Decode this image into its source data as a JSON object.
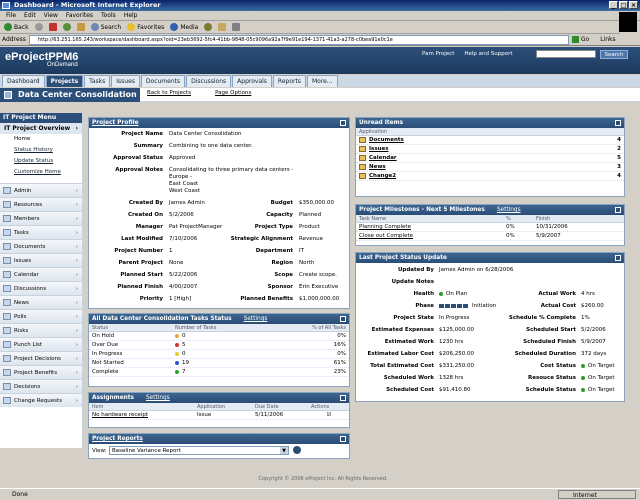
{
  "window": {
    "title": "Dashboard - Microsoft Internet Explorer"
  },
  "menubar": [
    "File",
    "Edit",
    "View",
    "Favorites",
    "Tools",
    "Help"
  ],
  "toolbar": {
    "back": "Back",
    "search": "Search",
    "favorites": "Favorites",
    "media": "Media"
  },
  "address": {
    "label": "Address",
    "url": "http://63.251.165.243/workspace/dashboard.aspx?oid=23eb3692-5fc4-41bb-9848-05c9096a92a7f9e91e194-1371-41a3-a278-c0bea91e0c1e",
    "go": "Go",
    "links": "Links"
  },
  "app": {
    "logo": "eProjectPPM6",
    "logo_sub": "OnDemand",
    "top_links": [
      "Pam Project",
      "Help and Support"
    ],
    "search_button": "Search",
    "tabs": [
      "Dashboard",
      "Projects",
      "Tasks",
      "Issues",
      "Documents",
      "Discussions",
      "Approvals",
      "Reports",
      "More..."
    ],
    "active_tab": "Projects",
    "page_title": "Data Center Consolidation",
    "subnav": [
      "Back to Projects",
      "Page Options"
    ]
  },
  "left_menu": {
    "header": "IT Project Menu",
    "section": "IT Project Overview",
    "links": [
      "Home",
      "Status History",
      "Update Status",
      "Customize Home"
    ],
    "items": [
      "Admin",
      "Resources",
      "Members",
      "Tasks",
      "Documents",
      "Issues",
      "Calendar",
      "Discussions",
      "News",
      "Polls",
      "Risks",
      "Punch List",
      "Project Decisions",
      "Project Benefits",
      "Decisions",
      "Change Requests"
    ]
  },
  "profile": {
    "title": "Project Profile",
    "project_name_label": "Project Name",
    "project_name": "Data Center Consolidation",
    "summary_label": "Summary",
    "summary": "Combining to one data center.",
    "approval_status_label": "Approval Status",
    "approval_status": "Approved",
    "approval_notes_label": "Approval Notes",
    "approval_notes": [
      "Consolidating to three primary data centers -",
      "Europe -",
      "East Coast",
      "West Coast"
    ],
    "left": [
      {
        "label": "Created By",
        "value": "James Admin"
      },
      {
        "label": "Created On",
        "value": "5/2/2006"
      },
      {
        "label": "Manager",
        "value": "Pat ProjectManager"
      },
      {
        "label": "Last Modified",
        "value": "7/10/2006"
      },
      {
        "label": "Project Number",
        "value": "1"
      },
      {
        "label": "Parent Project",
        "value": "None"
      },
      {
        "label": "Planned Start",
        "value": "5/22/2006"
      },
      {
        "label": "Planned Finish",
        "value": "4/00/2007"
      },
      {
        "label": "Priority",
        "value": "1 [High]"
      }
    ],
    "right": [
      {
        "label": "Budget",
        "value": "$350,000.00"
      },
      {
        "label": "Capacity",
        "value": "Planned"
      },
      {
        "label": "Project Type",
        "value": "Product"
      },
      {
        "label": "Strategic Alignment",
        "value": "Revenue"
      },
      {
        "label": "Department",
        "value": "IT"
      },
      {
        "label": "Region",
        "value": "North"
      },
      {
        "label": "Scope",
        "value": "Create scope."
      },
      {
        "label": "Sponsor",
        "value": "Erin Executive"
      },
      {
        "label": "Planned Benefits",
        "value": "$1,000,000.00"
      }
    ]
  },
  "tasks_status": {
    "title": "All Data Center Consolidation Tasks Status",
    "settings": "Settings",
    "columns": [
      "Status",
      "Number of Tasks",
      "% of All Tasks"
    ],
    "rows": [
      {
        "status": "On Hold",
        "count": "0",
        "pct": "0%",
        "color": "#e8a33c"
      },
      {
        "status": "Over Due",
        "count": "5",
        "pct": "16%",
        "color": "#d03030"
      },
      {
        "status": "In Progress",
        "count": "0",
        "pct": "0%",
        "color": "#e8c83c"
      },
      {
        "status": "Not Started",
        "count": "19",
        "pct": "61%",
        "color": "#3050c0"
      },
      {
        "status": "Complete",
        "count": "7",
        "pct": "23%",
        "color": "#30a030"
      }
    ]
  },
  "assignments": {
    "title": "Assignments",
    "settings": "Settings",
    "columns": [
      "Item",
      "Application",
      "Due Date",
      "Actions"
    ],
    "rows": [
      {
        "item": "No hardware receipt",
        "application": "Issue",
        "due": "5/11/2006"
      }
    ]
  },
  "reports": {
    "title": "Project Reports",
    "view_label": "View:",
    "selected": "Baseline Variance Report"
  },
  "unread": {
    "title": "Unread Items",
    "column": "Application",
    "rows": [
      {
        "name": "Documents",
        "count": "4"
      },
      {
        "name": "Issues",
        "count": "2"
      },
      {
        "name": "Calendar",
        "count": "5"
      },
      {
        "name": "News",
        "count": "3"
      },
      {
        "name": "Change2",
        "count": "4"
      }
    ]
  },
  "milestones": {
    "title": "Project Milestones - Next 5 Milestones",
    "settings": "Settings",
    "columns": [
      "Task Name",
      "%",
      "Finish"
    ],
    "rows": [
      {
        "name": "Planning Complete",
        "pct": "0%",
        "finish": "10/31/2006"
      },
      {
        "name": "Close out Complete",
        "pct": "0%",
        "finish": "5/9/2007"
      }
    ]
  },
  "status_update": {
    "title": "Last Project Status Update",
    "updated_by_label": "Updated By",
    "updated_by": "James Admin on 6/28/2006",
    "update_notes_label": "Update Notes",
    "health_label": "Health",
    "health": "On Plan",
    "phase_label": "Phase",
    "phase": "Initiation",
    "left": [
      {
        "label": "Project State",
        "value": "In Progress"
      },
      {
        "label": "Estimated Expenses",
        "value": "$125,000.00"
      },
      {
        "label": "Estimated Work",
        "value": "1230 hrs"
      },
      {
        "label": "Estimated Labor Cost",
        "value": "$206,250.00"
      },
      {
        "label": "Total Estimated Cost",
        "value": "$331,250.00"
      },
      {
        "label": "Scheduled Work",
        "value": "1328 hrs"
      },
      {
        "label": "Scheduled Cost",
        "value": "$91,410.80"
      }
    ],
    "right": [
      {
        "label": "Actual Work",
        "value": "4 hrs"
      },
      {
        "label": "Actual Cost",
        "value": "$260.00"
      },
      {
        "label": "Schedule % Complete",
        "value": "1%"
      },
      {
        "label": "Scheduled Start",
        "value": "5/2/2006"
      },
      {
        "label": "Scheduled Finish",
        "value": "5/9/2007"
      },
      {
        "label": "Scheduled Duration",
        "value": "372 days"
      },
      {
        "label": "Cost Status",
        "value": "On Target"
      },
      {
        "label": "Resouce Status",
        "value": "On Target"
      },
      {
        "label": "Schedule Status",
        "value": "On Target"
      }
    ]
  },
  "footer": "Copyright © 2006 eProject Inc. All Rights Reserved.",
  "statusbar": {
    "left": "Done",
    "zone": "Internet"
  },
  "colors": {
    "header": "#2c4f7a",
    "ok": "#2e9a2e"
  }
}
